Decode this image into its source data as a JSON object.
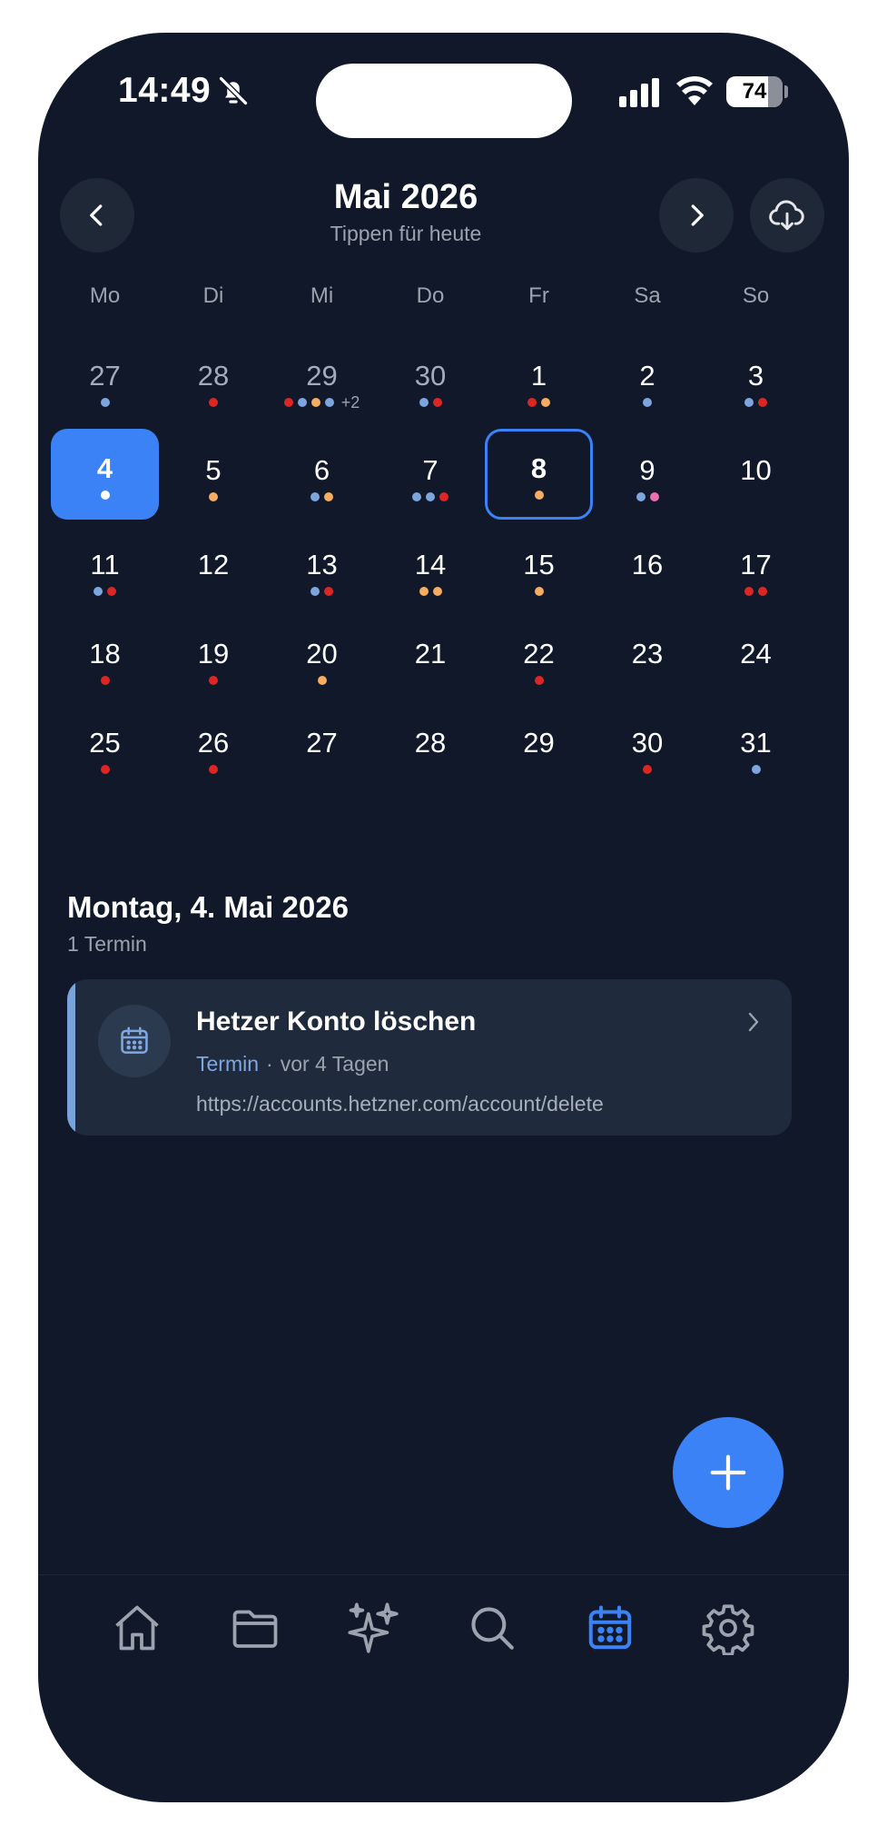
{
  "status_bar": {
    "time": "14:49",
    "battery": "74"
  },
  "header": {
    "title": "Mai 2026",
    "subtitle": "Tippen für heute"
  },
  "weekdays": [
    "Mo",
    "Di",
    "Mi",
    "Do",
    "Fr",
    "Sa",
    "So"
  ],
  "colors": {
    "blue": "#7ea5dd",
    "red": "#dc2626",
    "orange": "#f4ad61",
    "pink": "#ec6fb0",
    "white": "#ffffff",
    "accent": "#3b82f6"
  },
  "weeks": [
    [
      {
        "n": "27",
        "dim": true,
        "dots": [
          "blue"
        ]
      },
      {
        "n": "28",
        "dim": true,
        "dots": [
          "red"
        ]
      },
      {
        "n": "29",
        "dim": true,
        "dots": [
          "red",
          "blue",
          "orange",
          "blue"
        ],
        "more": "+2"
      },
      {
        "n": "30",
        "dim": true,
        "dots": [
          "blue",
          "red"
        ]
      },
      {
        "n": "1",
        "dots": [
          "red",
          "orange"
        ]
      },
      {
        "n": "2",
        "dots": [
          "blue"
        ]
      },
      {
        "n": "3",
        "dots": [
          "blue",
          "red"
        ]
      }
    ],
    [
      {
        "n": "4",
        "selected": true,
        "dots": [
          "white"
        ]
      },
      {
        "n": "5",
        "dots": [
          "orange"
        ]
      },
      {
        "n": "6",
        "dots": [
          "blue",
          "orange"
        ]
      },
      {
        "n": "7",
        "dots": [
          "blue",
          "blue",
          "red"
        ]
      },
      {
        "n": "8",
        "today": true,
        "dots": [
          "orange"
        ]
      },
      {
        "n": "9",
        "dots": [
          "blue",
          "pink"
        ]
      },
      {
        "n": "10",
        "dots": []
      }
    ],
    [
      {
        "n": "11",
        "dots": [
          "blue",
          "red"
        ]
      },
      {
        "n": "12",
        "dots": []
      },
      {
        "n": "13",
        "dots": [
          "blue",
          "red"
        ]
      },
      {
        "n": "14",
        "dots": [
          "orange",
          "orange"
        ]
      },
      {
        "n": "15",
        "dots": [
          "orange"
        ]
      },
      {
        "n": "16",
        "dots": []
      },
      {
        "n": "17",
        "dots": [
          "red",
          "red"
        ]
      }
    ],
    [
      {
        "n": "18",
        "dots": [
          "red"
        ]
      },
      {
        "n": "19",
        "dots": [
          "red"
        ]
      },
      {
        "n": "20",
        "dots": [
          "orange"
        ]
      },
      {
        "n": "21",
        "dots": []
      },
      {
        "n": "22",
        "dots": [
          "red"
        ]
      },
      {
        "n": "23",
        "dots": []
      },
      {
        "n": "24",
        "dots": []
      }
    ],
    [
      {
        "n": "25",
        "dots": [
          "red"
        ]
      },
      {
        "n": "26",
        "dots": [
          "red"
        ]
      },
      {
        "n": "27",
        "dots": []
      },
      {
        "n": "28",
        "dots": []
      },
      {
        "n": "29",
        "dots": []
      },
      {
        "n": "30",
        "dots": [
          "red"
        ]
      },
      {
        "n": "31",
        "dots": [
          "blue"
        ]
      }
    ]
  ],
  "agenda": {
    "date_title": "Montag, 4. Mai 2026",
    "count": "1 Termin",
    "event": {
      "title": "Hetzer Konto löschen",
      "type": "Termin",
      "separator": "·",
      "when": "vor 4 Tagen",
      "url": "https://accounts.hetzner.com/account/delete"
    }
  },
  "tabbar": {
    "items": [
      {
        "icon": "home-icon",
        "active": false
      },
      {
        "icon": "folder-icon",
        "active": false
      },
      {
        "icon": "sparkles-icon",
        "active": false
      },
      {
        "icon": "search-icon",
        "active": false
      },
      {
        "icon": "calendar-icon",
        "active": true
      },
      {
        "icon": "settings-icon",
        "active": false
      }
    ]
  }
}
